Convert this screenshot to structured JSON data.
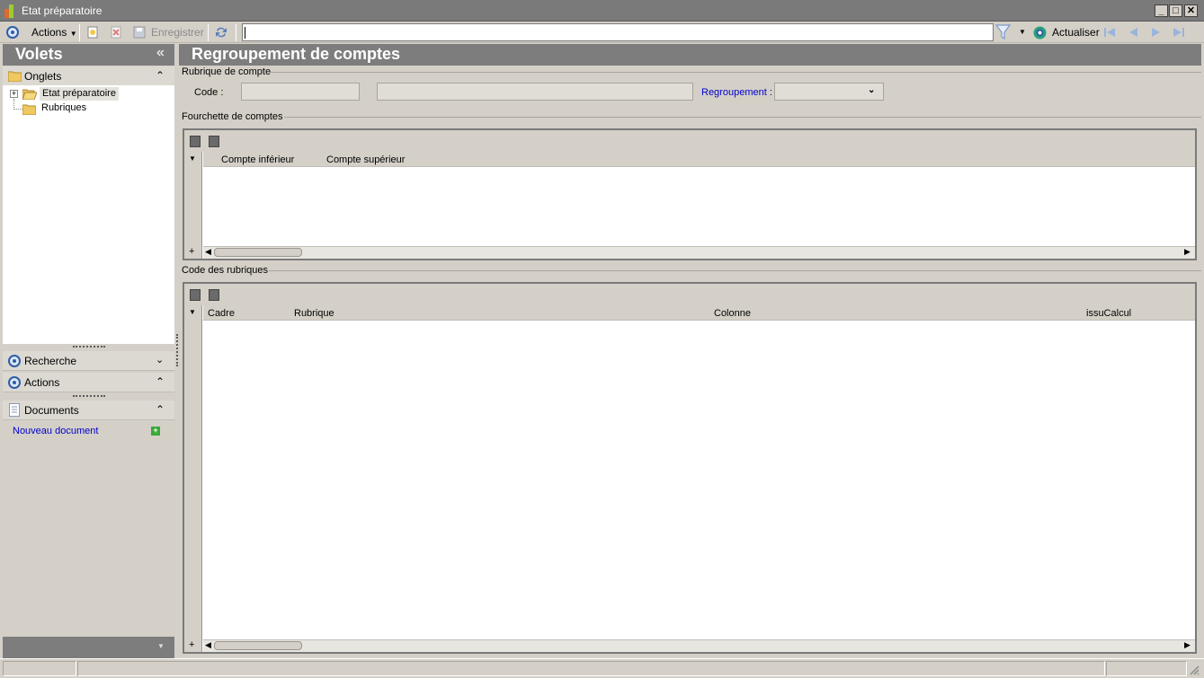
{
  "window": {
    "title": "Etat préparatoire",
    "minimize": "_",
    "maximize": "□",
    "close": "✕"
  },
  "toolbar": {
    "actions_label": "Actions",
    "save_label": "Enregistrer",
    "refresh_label": "Actualiser",
    "search_value": ""
  },
  "sidebar": {
    "title": "Volets",
    "collapse_glyph": "«",
    "onglets_label": "Onglets",
    "tree": [
      {
        "label": "Etat préparatoire",
        "expander": "+"
      },
      {
        "label": "Rubriques"
      }
    ],
    "recherche_label": "Recherche",
    "actions_label": "Actions",
    "documents_label": "Documents",
    "new_document_label": "Nouveau document"
  },
  "main": {
    "title": "Regroupement de comptes",
    "rubrique_section": "Rubrique de compte",
    "code_label": "Code :",
    "code_value": "",
    "description_value": "",
    "regroupement_label": "Regroupement :",
    "regroupement_value": "",
    "fourchette_section": "Fourchette de comptes",
    "fourchette_columns": [
      "Compte inférieur",
      "Compte supérieur"
    ],
    "code_rubriques_section": "Code des rubriques",
    "rubriques_columns": [
      "Cadre",
      "Rubrique",
      "Colonne",
      "issuCalcul"
    ],
    "add_row_glyph": "+"
  },
  "colors": {
    "header_bg": "#7d7d7d",
    "link": "#0000cc",
    "accent": "#2e5da8"
  }
}
